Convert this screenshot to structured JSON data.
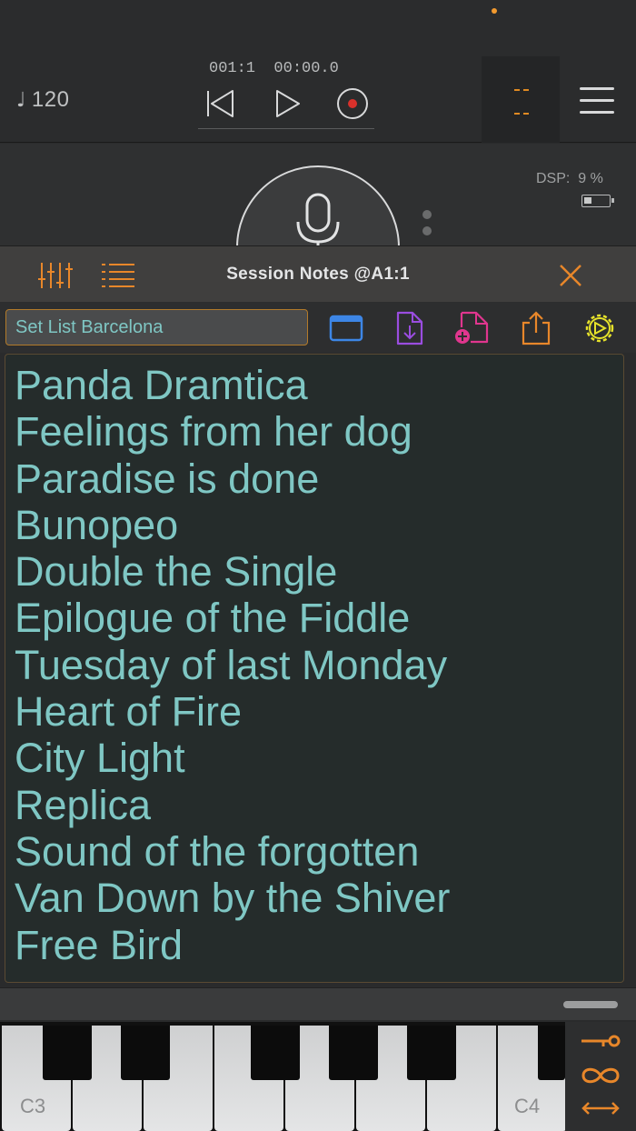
{
  "transport": {
    "tempo_symbol": "♩",
    "tempo_value": "120",
    "position": "001:1",
    "time": "00:00.0",
    "rewind_icon": "rewind-icon",
    "play_icon": "play-icon",
    "record_icon": "record-icon",
    "meter_icon": "level-meter-icon",
    "menu_icon": "hamburger-menu-icon"
  },
  "recorder": {
    "mic_icon": "microphone-icon",
    "dsp_label": "DSP:  9 %"
  },
  "panel": {
    "title": "Session Notes @A1:1",
    "mixer_icon": "mixer-sliders-icon",
    "list_icon": "list-icon",
    "close_icon": "close-icon"
  },
  "toolbar": {
    "note_name": "Set List Barcelona",
    "icons": [
      "window-icon",
      "import-file-icon",
      "new-file-icon",
      "share-icon",
      "settings-gear-icon"
    ]
  },
  "notes": [
    "Panda Dramtica",
    "Feelings from her dog",
    "Paradise is done",
    "Bunopeo",
    "Double the Single",
    "Epilogue of the Fiddle",
    "Tuesday of last Monday",
    "Heart of Fire",
    "City Light",
    "Replica",
    "Sound of the forgotten",
    "Van Down by the Shiver",
    "Free Bird"
  ],
  "keyboard": {
    "label_c3": "C3",
    "label_c4": "C4",
    "side_icons": [
      "key-icon",
      "infinity-icon",
      "range-arrows-icon"
    ]
  },
  "colors": {
    "accent_orange": "#e8872a",
    "note_text": "#7fc7c4",
    "record_red": "#d9312b"
  }
}
